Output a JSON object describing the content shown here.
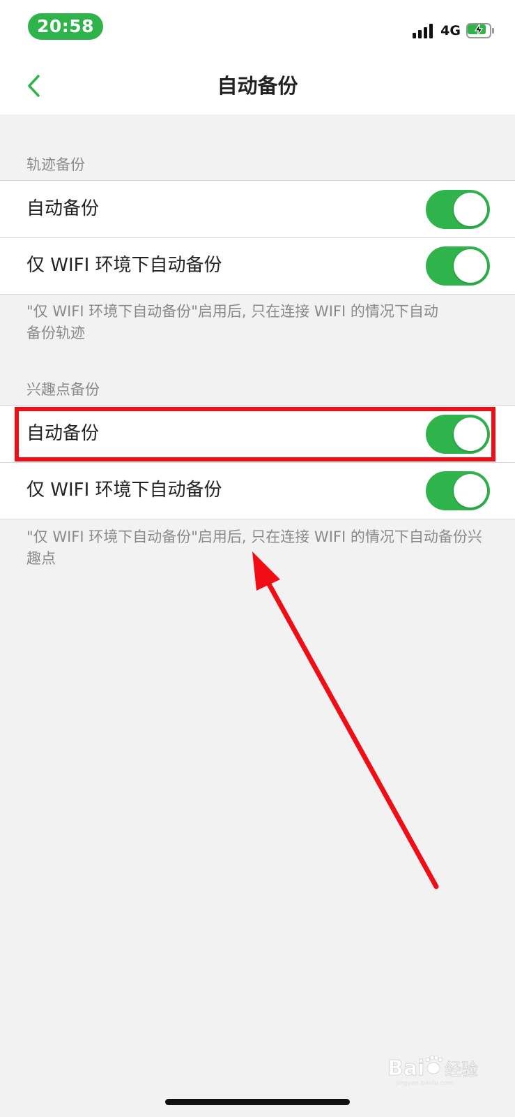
{
  "status_bar": {
    "time": "20:58",
    "network": "4G",
    "icons": [
      "signal-icon",
      "battery-charging-icon"
    ],
    "time_pill_color": "#2fb44c"
  },
  "nav": {
    "back_icon": "chevron-left-icon",
    "title": "自动备份"
  },
  "sections": [
    {
      "header": "轨迹备份",
      "rows": [
        {
          "label": "自动备份",
          "toggle_on": true
        },
        {
          "label": "仅 WIFI 环境下自动备份",
          "toggle_on": true
        }
      ],
      "footnote": "\"仅 WIFI 环境下自动备份\"启用后, 只在连接 WIFI 的情况下自动备份轨迹"
    },
    {
      "header": "兴趣点备份",
      "rows": [
        {
          "label": "自动备份",
          "toggle_on": true
        },
        {
          "label": "仅 WIFI 环境下自动备份",
          "toggle_on": true
        }
      ],
      "footnote": "\"仅 WIFI 环境下自动备份\"启用后, 只在连接 WIFI 的情况下自动备份兴趣点"
    }
  ],
  "colors": {
    "accent": "#2fb44c",
    "background": "#f2f2f2",
    "annotation": "#f00d16"
  },
  "annotations": {
    "highlight": "red-highlight-box",
    "arrow": "red-arrow-icon"
  },
  "watermark": {
    "icon": "baidu-paw-logo",
    "text": "Baidu 经验",
    "subtext": "jingyan.baidu.com"
  }
}
